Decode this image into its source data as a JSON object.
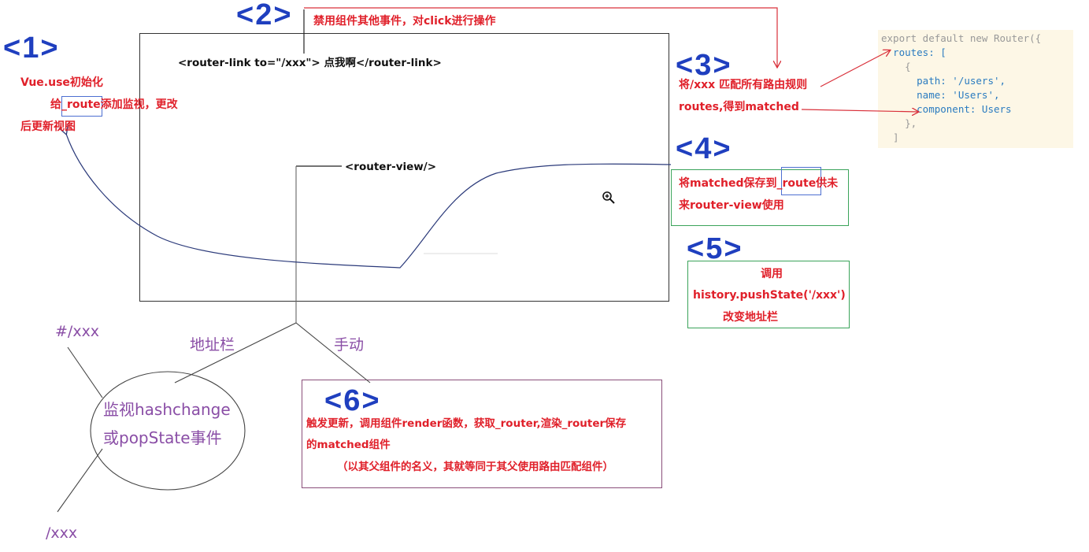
{
  "step1": {
    "num": "<1>",
    "line1": "Vue.use初始化",
    "line2": "给_route添加监视，更改",
    "line3": "后更新视图"
  },
  "step2": {
    "num": "<2>",
    "text": "禁用组件其他事件，对click进行操作"
  },
  "router_link": "<router-link to=\"/xxx\"> 点我啊</router-link>",
  "router_view": "<router-view/>",
  "step3": {
    "num": "<3>",
    "line1": "将/xxx 匹配所有路由规则",
    "line2": "routes,得到matched"
  },
  "code": {
    "lines": [
      "export default new Router({",
      "  routes: [",
      "    {",
      "      path: '/users',",
      "      name: 'Users',",
      "      component: Users",
      "    },",
      "  ]"
    ]
  },
  "step4": {
    "num": "<4>",
    "line1": "将matched保存到_route供未",
    "line2": "来router-view使用"
  },
  "step5": {
    "num": "<5>",
    "line1": "调用",
    "line2": "history.pushState('/xxx')",
    "line3": "改变地址栏"
  },
  "branch": {
    "address_bar": "地址栏",
    "manual": "手动",
    "hash_url": "#/xxx",
    "path_url": "/xxx",
    "watch_line1": "监视hashchange",
    "watch_line2": "或popState事件"
  },
  "step6": {
    "num": "<6>",
    "line1": "触发更新，调用组件render函数，获取_router,渲染_router保存",
    "line2": "的matched组件",
    "line3": "（以其父组件的名义，其就等同于其父使用路由匹配组件）"
  },
  "colors": {
    "step_number": "#1f3fbf",
    "red_text": "#e0202a",
    "purple_text": "#8a4ea6",
    "green_frame": "#3aa35a",
    "code_bg": "#fdf7e6"
  },
  "icons": {
    "zoom": "zoom-in-icon"
  }
}
